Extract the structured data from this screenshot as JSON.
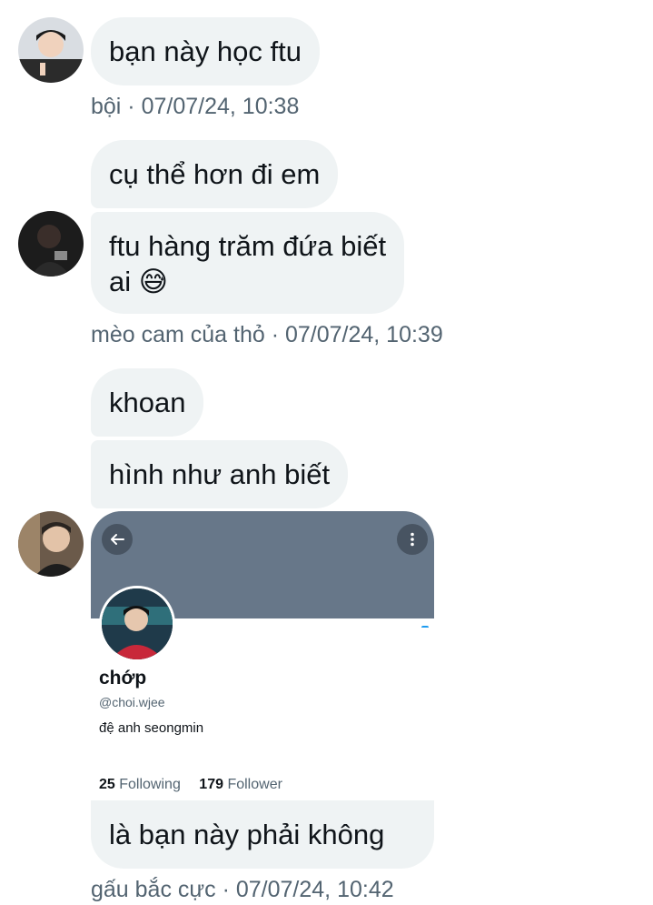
{
  "thread": {
    "msg1": {
      "text": "bạn này học ftu"
    },
    "meta1": {
      "sender": "bội",
      "timestamp": "07/07/24, 10:38",
      "line": "bội · 07/07/24, 10:38"
    },
    "msg2": {
      "text": "cụ thể hơn đi em"
    },
    "msg3": {
      "line1": "ftu hàng trăm đứa biết",
      "line2": "ai 😅"
    },
    "meta2": {
      "sender": "mèo cam của thỏ",
      "timestamp": "07/07/24, 10:39",
      "line": "mèo cam của thỏ · 07/07/24, 10:39"
    },
    "msg4": {
      "text": "khoan"
    },
    "msg5": {
      "text": "hình như anh biết"
    },
    "profile_card": {
      "name": "chớp",
      "handle": "@choi.wjee",
      "bio": "đệ anh seongmin",
      "following_count": "25",
      "following_label": "Following",
      "follower_count": "179",
      "follower_label": "Follower",
      "banner_color": "#677789",
      "back_icon": "arrow-left-icon",
      "more_icon": "more-vertical-icon"
    },
    "msg6": {
      "text": "là bạn này phải không"
    },
    "meta3": {
      "sender": "gấu bắc cực",
      "timestamp": "07/07/24, 10:42",
      "line": "gấu bắc cực · 07/07/24, 10:42"
    }
  },
  "colors": {
    "bubble": "#eff3f4",
    "meta_text": "#536471",
    "text": "#0f1419"
  }
}
